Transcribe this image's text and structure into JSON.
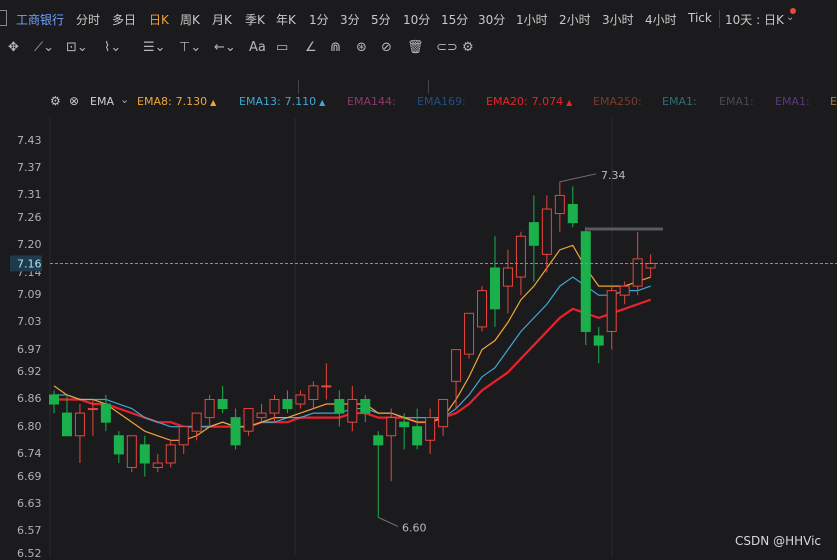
{
  "app": {
    "stock_name": "工商银行"
  },
  "periods": [
    "分时",
    "多日",
    "日K",
    "周K",
    "月K",
    "季K",
    "年K",
    "1分",
    "3分",
    "5分",
    "10分",
    "15分",
    "30分",
    "1小时",
    "2小时",
    "3小时",
    "4小时",
    "Tick"
  ],
  "active_period": "日K",
  "range_select": "10天 : 日K",
  "indicator": {
    "name": "EMA",
    "lines": [
      {
        "label": "EMA8:",
        "value": "7.130",
        "color": "#f0a43a",
        "arrow": "▲"
      },
      {
        "label": "EMA13:",
        "value": "7.110",
        "color": "#3fa7d6",
        "arrow": "▲"
      },
      {
        "label": "EMA144:",
        "value": "",
        "color": "#8a3b6b",
        "arrow": ""
      },
      {
        "label": "EMA169:",
        "value": "",
        "color": "#244e80",
        "arrow": ""
      },
      {
        "label": "EMA20:",
        "value": "7.074",
        "color": "#e8232b",
        "arrow": "▲"
      },
      {
        "label": "EMA250:",
        "value": "",
        "color": "#7a3a2a",
        "arrow": ""
      },
      {
        "label": "EMA1:",
        "value": "",
        "color": "#2f6f73",
        "arrow": ""
      },
      {
        "label": "EMA1:",
        "value": "",
        "color": "#4a4a4a",
        "arrow": ""
      },
      {
        "label": "EMA1:",
        "value": "",
        "color": "#5a3a7a",
        "arrow": ""
      },
      {
        "label": "E",
        "value": "",
        "color": "#b07b2a",
        "arrow": ""
      }
    ]
  },
  "y_axis": [
    "7.43",
    "7.37",
    "7.31",
    "7.26",
    "7.20",
    "7.14",
    "7.09",
    "7.03",
    "6.97",
    "6.92",
    "6.86",
    "6.80",
    "6.74",
    "6.69",
    "6.63",
    "6.57",
    "6.52"
  ],
  "current_price": "7.16",
  "high_label": "7.34",
  "low_label": "6.60",
  "watermark": "CSDN @HHVic",
  "colors": {
    "up": "#e8453c",
    "down": "#1bb04c",
    "ema8": "#f0a43a",
    "ema13": "#3fa7d6",
    "ema20": "#e8232b",
    "grid": "#2a2b2e",
    "price_line": "#e8733a"
  },
  "chart_data": {
    "type": "candlestick",
    "ylim": [
      6.52,
      7.46
    ],
    "candles": [
      {
        "o": 6.87,
        "h": 6.88,
        "l": 6.83,
        "c": 6.85
      },
      {
        "o": 6.83,
        "h": 6.87,
        "l": 6.79,
        "c": 6.78
      },
      {
        "o": 6.78,
        "h": 6.85,
        "l": 6.72,
        "c": 6.83
      },
      {
        "o": 6.84,
        "h": 6.86,
        "l": 6.78,
        "c": 6.84
      },
      {
        "o": 6.85,
        "h": 6.87,
        "l": 6.79,
        "c": 6.81
      },
      {
        "o": 6.78,
        "h": 6.79,
        "l": 6.72,
        "c": 6.74
      },
      {
        "o": 6.71,
        "h": 6.78,
        "l": 6.7,
        "c": 6.78
      },
      {
        "o": 6.76,
        "h": 6.78,
        "l": 6.69,
        "c": 6.72
      },
      {
        "o": 6.71,
        "h": 6.74,
        "l": 6.7,
        "c": 6.72
      },
      {
        "o": 6.72,
        "h": 6.77,
        "l": 6.71,
        "c": 6.76
      },
      {
        "o": 6.76,
        "h": 6.8,
        "l": 6.74,
        "c": 6.8
      },
      {
        "o": 6.79,
        "h": 6.83,
        "l": 6.77,
        "c": 6.83
      },
      {
        "o": 6.82,
        "h": 6.87,
        "l": 6.8,
        "c": 6.86
      },
      {
        "o": 6.86,
        "h": 6.89,
        "l": 6.83,
        "c": 6.84
      },
      {
        "o": 6.82,
        "h": 6.84,
        "l": 6.75,
        "c": 6.76
      },
      {
        "o": 6.79,
        "h": 6.84,
        "l": 6.78,
        "c": 6.84
      },
      {
        "o": 6.82,
        "h": 6.85,
        "l": 6.81,
        "c": 6.83
      },
      {
        "o": 6.83,
        "h": 6.87,
        "l": 6.81,
        "c": 6.86
      },
      {
        "o": 6.86,
        "h": 6.88,
        "l": 6.83,
        "c": 6.84
      },
      {
        "o": 6.85,
        "h": 6.88,
        "l": 6.84,
        "c": 6.87
      },
      {
        "o": 6.86,
        "h": 6.9,
        "l": 6.84,
        "c": 6.89
      },
      {
        "o": 6.89,
        "h": 6.94,
        "l": 6.86,
        "c": 6.89
      },
      {
        "o": 6.86,
        "h": 6.88,
        "l": 6.8,
        "c": 6.83
      },
      {
        "o": 6.81,
        "h": 6.89,
        "l": 6.79,
        "c": 6.86
      },
      {
        "o": 6.86,
        "h": 6.87,
        "l": 6.81,
        "c": 6.83
      },
      {
        "o": 6.78,
        "h": 6.79,
        "l": 6.6,
        "c": 6.76
      },
      {
        "o": 6.78,
        "h": 6.84,
        "l": 6.68,
        "c": 6.82
      },
      {
        "o": 6.81,
        "h": 6.83,
        "l": 6.75,
        "c": 6.8
      },
      {
        "o": 6.8,
        "h": 6.84,
        "l": 6.75,
        "c": 6.76
      },
      {
        "o": 6.77,
        "h": 6.84,
        "l": 6.74,
        "c": 6.82
      },
      {
        "o": 6.8,
        "h": 6.86,
        "l": 6.78,
        "c": 6.86
      },
      {
        "o": 6.9,
        "h": 6.97,
        "l": 6.84,
        "c": 6.97
      },
      {
        "o": 6.96,
        "h": 7.05,
        "l": 6.95,
        "c": 7.05
      },
      {
        "o": 7.02,
        "h": 7.11,
        "l": 7.01,
        "c": 7.1
      },
      {
        "o": 7.15,
        "h": 7.22,
        "l": 7.02,
        "c": 7.06
      },
      {
        "o": 7.11,
        "h": 7.19,
        "l": 7.05,
        "c": 7.15
      },
      {
        "o": 7.13,
        "h": 7.23,
        "l": 7.09,
        "c": 7.22
      },
      {
        "o": 7.25,
        "h": 7.31,
        "l": 7.12,
        "c": 7.2
      },
      {
        "o": 7.18,
        "h": 7.31,
        "l": 7.14,
        "c": 7.28
      },
      {
        "o": 7.27,
        "h": 7.34,
        "l": 7.23,
        "c": 7.31
      },
      {
        "o": 7.29,
        "h": 7.33,
        "l": 7.24,
        "c": 7.25
      },
      {
        "o": 7.23,
        "h": 7.24,
        "l": 6.98,
        "c": 7.01
      },
      {
        "o": 7.0,
        "h": 7.02,
        "l": 6.94,
        "c": 6.98
      },
      {
        "o": 7.01,
        "h": 7.11,
        "l": 6.97,
        "c": 7.1
      },
      {
        "o": 7.09,
        "h": 7.12,
        "l": 7.07,
        "c": 7.11
      },
      {
        "o": 7.11,
        "h": 7.23,
        "l": 7.09,
        "c": 7.17
      },
      {
        "o": 7.15,
        "h": 7.18,
        "l": 7.13,
        "c": 7.16
      }
    ],
    "ema8": [
      6.89,
      6.87,
      6.86,
      6.86,
      6.85,
      6.83,
      6.81,
      6.79,
      6.78,
      6.77,
      6.77,
      6.78,
      6.8,
      6.81,
      6.8,
      6.8,
      6.81,
      6.82,
      6.82,
      6.83,
      6.84,
      6.85,
      6.85,
      6.85,
      6.85,
      6.83,
      6.83,
      6.82,
      6.81,
      6.81,
      6.82,
      6.86,
      6.91,
      6.97,
      6.99,
      7.03,
      7.08,
      7.11,
      7.15,
      7.19,
      7.2,
      7.15,
      7.11,
      7.11,
      7.11,
      7.12,
      7.13
    ],
    "ema13": [
      6.87,
      6.87,
      6.86,
      6.86,
      6.86,
      6.85,
      6.84,
      6.82,
      6.81,
      6.8,
      6.8,
      6.8,
      6.8,
      6.81,
      6.8,
      6.8,
      6.81,
      6.81,
      6.82,
      6.82,
      6.83,
      6.83,
      6.83,
      6.84,
      6.84,
      6.83,
      6.83,
      6.82,
      6.82,
      6.82,
      6.82,
      6.84,
      6.87,
      6.91,
      6.93,
      6.97,
      7.01,
      7.04,
      7.07,
      7.11,
      7.13,
      7.11,
      7.09,
      7.09,
      7.1,
      7.1,
      7.11
    ],
    "ema20": [
      6.86,
      6.86,
      6.86,
      6.85,
      6.85,
      6.84,
      6.83,
      6.82,
      6.81,
      6.81,
      6.8,
      6.8,
      6.8,
      6.8,
      6.8,
      6.8,
      6.81,
      6.81,
      6.81,
      6.82,
      6.82,
      6.82,
      6.82,
      6.83,
      6.83,
      6.82,
      6.82,
      6.82,
      6.81,
      6.81,
      6.82,
      6.83,
      6.85,
      6.88,
      6.9,
      6.92,
      6.95,
      6.98,
      7.01,
      7.04,
      7.06,
      7.05,
      7.04,
      7.05,
      7.06,
      7.07,
      7.08
    ]
  }
}
